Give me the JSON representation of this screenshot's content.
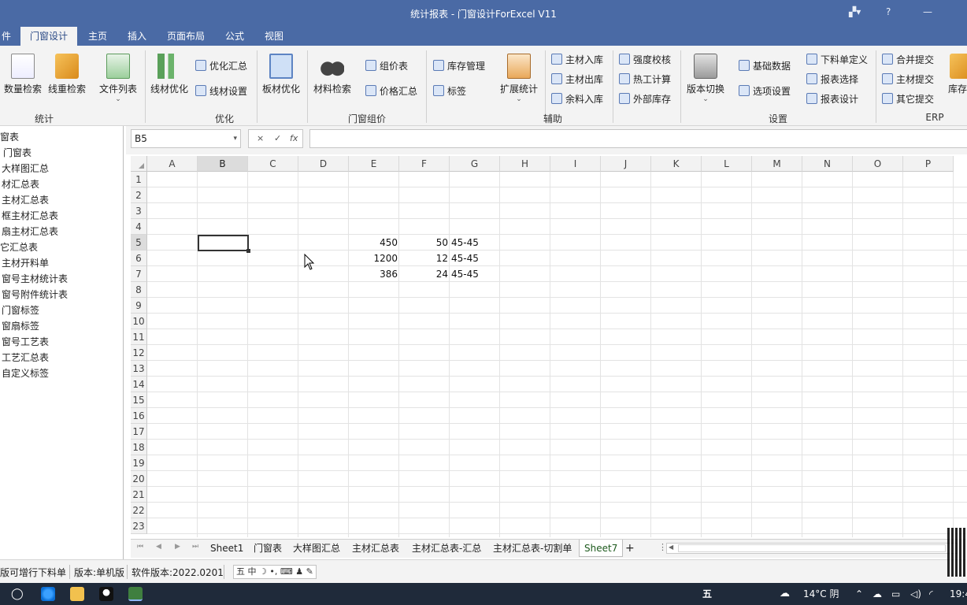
{
  "window": {
    "title": "统计报表 - 门窗设计ForExcel V11"
  },
  "menu": {
    "tabs": [
      "件",
      "门窗设计",
      "主页",
      "插入",
      "页面布局",
      "公式",
      "视图"
    ],
    "active": "门窗设计"
  },
  "ribbon": {
    "groups": {
      "stats": "统计",
      "optimize": "优化",
      "price": "门窗组价",
      "aux": "辅助",
      "settings": "设置",
      "erp": "ERP"
    },
    "buttons": {
      "qty_search": "数量检索",
      "weight_search": "线重检索",
      "file_list": "文件列表",
      "line_opt": "线材优化",
      "opt_summary": "优化汇总",
      "line_settings": "线材设置",
      "board_opt": "板材优化",
      "material_search": "材料检索",
      "price_table": "组价表",
      "price_summary": "价格汇总",
      "inventory": "库存管理",
      "label": "标签",
      "ext_stats": "扩展统计",
      "main_in": "主材入库",
      "main_out": "主材出库",
      "remain_in": "余料入库",
      "strength_check": "强度校核",
      "thermal_calc": "热工计算",
      "ext_inventory": "外部库存",
      "version_switch": "版本切换",
      "base_data": "基础数据",
      "option_settings": "选项设置",
      "cut_def": "下料单定义",
      "report_select": "报表选择",
      "report_design": "报表设计",
      "merge_submit": "合并提交",
      "main_submit": "主材提交",
      "other_submit": "其它提交",
      "store": "库存"
    }
  },
  "formula": {
    "namebox": "B5",
    "cancel": "×",
    "confirm": "✓",
    "fx": "fx",
    "value": ""
  },
  "left_pane": {
    "items": [
      "窗表",
      "门窗表",
      "大样图汇总",
      "材汇总表",
      "主材汇总表",
      "框主材汇总表",
      "扇主材汇总表",
      "它汇总表",
      "主材开料单",
      "窗号主材统计表",
      "窗号附件统计表",
      "门窗标签",
      "窗扇标签",
      "窗号工艺表",
      "工艺汇总表",
      "自定义标签"
    ]
  },
  "grid": {
    "columns": [
      "A",
      "B",
      "C",
      "D",
      "E",
      "F",
      "G",
      "H",
      "I",
      "J",
      "K",
      "L",
      "M",
      "N",
      "O",
      "P"
    ],
    "rows": [
      "1",
      "2",
      "3",
      "4",
      "5",
      "6",
      "7",
      "8",
      "9",
      "10",
      "11",
      "12",
      "13",
      "14",
      "15",
      "16",
      "17",
      "18",
      "19",
      "20",
      "21",
      "22",
      "23"
    ],
    "cells": {
      "E5": "450",
      "F5": "50",
      "G5": "45-45",
      "E6": "1200",
      "F6": "12",
      "G6": "45-45",
      "E7": "386",
      "F7": "24",
      "G7": "45-45"
    }
  },
  "sheets": {
    "tabs": [
      "Sheet1",
      "门窗表",
      "大样图汇总",
      "主材汇总表",
      "主材汇总表-汇总",
      "主材汇总表-切割单",
      "Sheet7"
    ],
    "active": "Sheet7",
    "add": "+"
  },
  "status": {
    "mode": "版可增行下料单",
    "edition": "版本:单机版",
    "software": "软件版本:2022.0201",
    "ime": "五 中 ☽ •, ⌨ ♟ ✎"
  },
  "taskbar": {
    "ime_char": "五",
    "weather": "14°C 阴",
    "time": "19:4"
  }
}
